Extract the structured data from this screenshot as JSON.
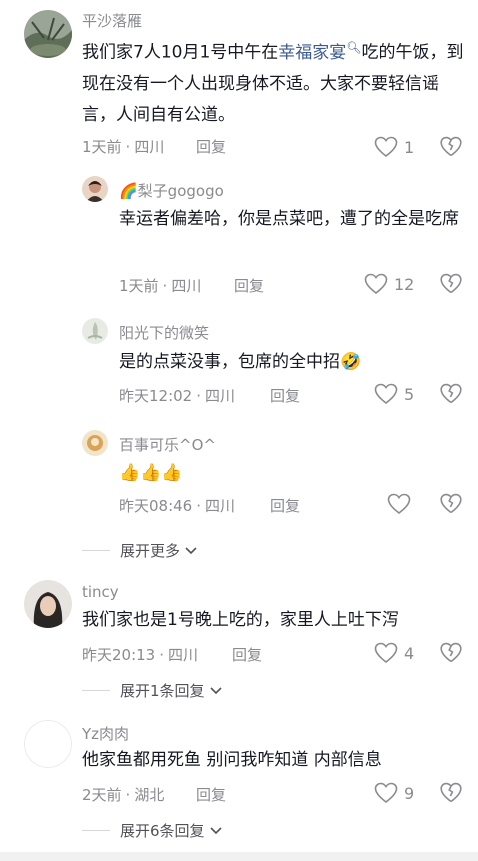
{
  "comments": [
    {
      "user": "平沙落雁",
      "text_before": "我们家7人10月1号中午在",
      "mention": "幸福家宴",
      "text_after_line1": "吃的午",
      "text_rest": "饭，到现在没有一个人出现身体不适。大家不要轻信谣言，人间自有公道。",
      "time": "1天前",
      "location": "四川",
      "reply_label": "回复",
      "likes": "1"
    },
    {
      "user": "🌈梨子gogogo",
      "text": "幸运者偏差哈，你是点菜吧，遭了的全是吃席",
      "time": "1天前",
      "location": "四川",
      "reply_label": "回复",
      "likes": "12"
    },
    {
      "user": "阳光下的微笑",
      "text": "是的点菜没事，包席的全中招🤣",
      "time": "昨天12:02",
      "location": "四川",
      "reply_label": "回复",
      "likes": "5"
    },
    {
      "user": "百事可乐^O^",
      "text": "👍👍👍",
      "time": "昨天08:46",
      "location": "四川",
      "reply_label": "回复",
      "likes": ""
    },
    {
      "user": "tincy",
      "text": "我们家也是1号晚上吃的，家里人上吐下泻",
      "time": "昨天20:13",
      "location": "四川",
      "reply_label": "回复",
      "likes": "4"
    },
    {
      "user": "Yz肉肉",
      "text": "他家鱼都用死鱼 别问我咋知道 内部信息",
      "time": "2天前",
      "location": "湖北",
      "reply_label": "回复",
      "likes": "9"
    }
  ],
  "expanders": {
    "more": "展开更多",
    "replies_1": "展开1条回复",
    "replies_6": "展开6条回复"
  },
  "colors": {
    "text": "#161823",
    "secondary": "#8a8b91",
    "mention": "#3b5a91"
  }
}
